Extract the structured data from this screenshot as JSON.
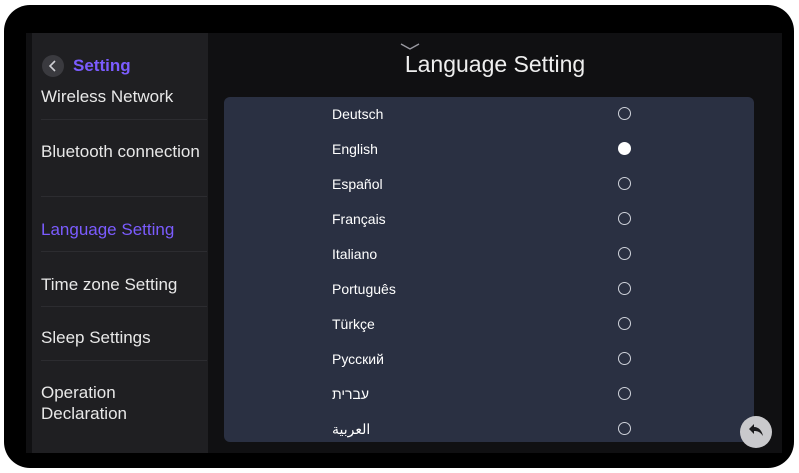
{
  "sidebar": {
    "header": "Setting",
    "items": [
      {
        "label": "Wireless Network",
        "active": false
      },
      {
        "label": "Bluetooth connection",
        "active": false
      },
      {
        "label": "Language Setting",
        "active": true
      },
      {
        "label": "Time zone Setting",
        "active": false
      },
      {
        "label": "Sleep Settings",
        "active": false
      },
      {
        "label": "Operation Declaration",
        "active": false
      }
    ]
  },
  "main": {
    "title": "Language Setting",
    "languages": [
      {
        "label": "Deutsch",
        "selected": false
      },
      {
        "label": "English",
        "selected": true
      },
      {
        "label": "Español",
        "selected": false
      },
      {
        "label": "Français",
        "selected": false
      },
      {
        "label": "Italiano",
        "selected": false
      },
      {
        "label": "Português",
        "selected": false
      },
      {
        "label": "Türkçe",
        "selected": false
      },
      {
        "label": "Русский",
        "selected": false
      },
      {
        "label": "עברית",
        "selected": false
      },
      {
        "label": "العربية",
        "selected": false
      }
    ]
  },
  "icons": {
    "back": "chevron-left-icon",
    "pull_down": "chevron-down-icon",
    "return": "return-arrow-icon"
  },
  "colors": {
    "accent": "#7b5cff",
    "panel": "#2a3042",
    "sidebar": "#1f1f22"
  }
}
